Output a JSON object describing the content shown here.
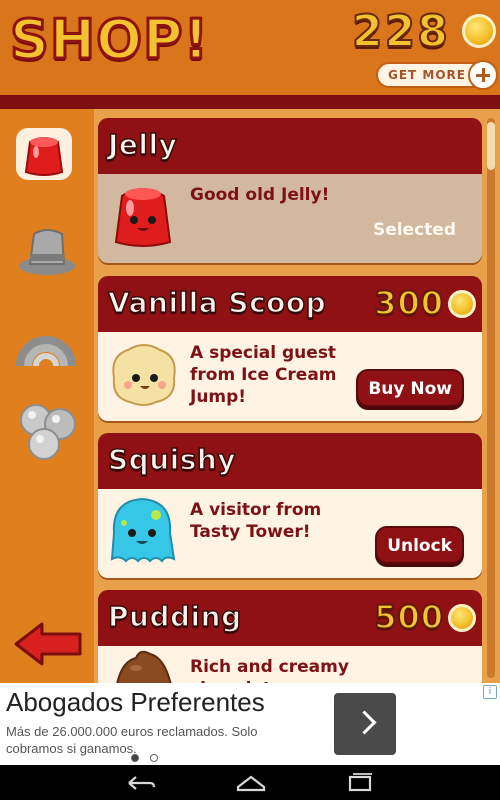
{
  "header": {
    "title": "SHOP!",
    "coins": "228",
    "get_more_label": "GET MORE"
  },
  "sidebar": {
    "categories": [
      {
        "name": "jelly",
        "icon": "jelly-icon",
        "active": true
      },
      {
        "name": "hat",
        "icon": "hat-icon"
      },
      {
        "name": "rainbow",
        "icon": "rainbow-icon"
      },
      {
        "name": "balls",
        "icon": "balls-icon"
      }
    ],
    "back_icon": "back-arrow-icon"
  },
  "items": [
    {
      "name": "Jelly",
      "description": "Good old Jelly!",
      "status": "Selected",
      "price": "",
      "action": ""
    },
    {
      "name": "Vanilla Scoop",
      "description": "A special guest from Ice Cream Jump!",
      "price": "300",
      "action": "Buy Now"
    },
    {
      "name": "Squishy",
      "description": "A visitor from Tasty Tower!",
      "price": "",
      "action": "Unlock"
    },
    {
      "name": "Pudding",
      "description": "Rich and creamy chocolate pudding!",
      "price": "500",
      "action": ""
    }
  ],
  "ad": {
    "title": "Abogados Preferentes",
    "body": "Más de 26.000.000 euros reclamados. Solo cobramos si ganamos."
  },
  "colors": {
    "background": "#e07f1e",
    "card_header": "#8f1113",
    "card_body": "#fff3e3",
    "selected_body": "#d1b89e",
    "coin": "#f4c230"
  }
}
